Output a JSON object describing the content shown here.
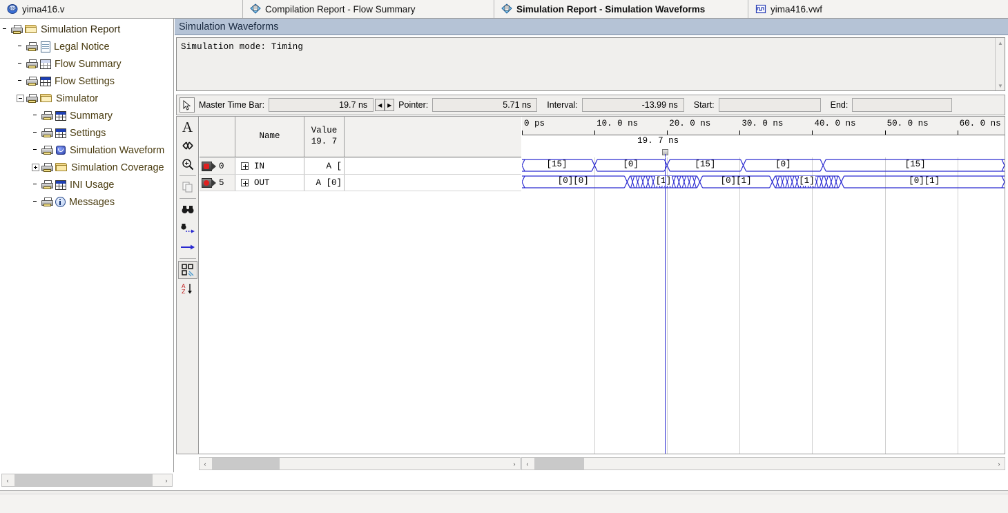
{
  "tabs": [
    {
      "label": "yima416.v",
      "icon": "verilog-file-icon",
      "active": false
    },
    {
      "label": "Compilation Report - Flow Summary",
      "icon": "report-icon",
      "active": false
    },
    {
      "label": "Simulation Report - Simulation Waveforms",
      "icon": "report-icon",
      "active": true
    },
    {
      "label": "yima416.vwf",
      "icon": "waveform-file-icon",
      "active": false
    }
  ],
  "tree": {
    "items": [
      {
        "label": "Simulation Report",
        "depth": 0,
        "icon": "folder-open-icon",
        "expander": "none"
      },
      {
        "label": "Legal Notice",
        "depth": 1,
        "icon": "document-icon",
        "expander": "none"
      },
      {
        "label": "Flow Summary",
        "depth": 1,
        "icon": "table-pale-icon",
        "expander": "none"
      },
      {
        "label": "Flow Settings",
        "depth": 1,
        "icon": "table-icon",
        "expander": "none"
      },
      {
        "label": "Simulator",
        "depth": 1,
        "icon": "folder-open-icon",
        "expander": "minus"
      },
      {
        "label": "Summary",
        "depth": 2,
        "icon": "table-icon",
        "expander": "none"
      },
      {
        "label": "Settings",
        "depth": 2,
        "icon": "table-icon",
        "expander": "none"
      },
      {
        "label": "Simulation Waveform",
        "depth": 2,
        "icon": "waveform-icon",
        "expander": "none"
      },
      {
        "label": "Simulation Coverage",
        "depth": 2,
        "icon": "folder-icon",
        "expander": "plus"
      },
      {
        "label": "INI Usage",
        "depth": 2,
        "icon": "table-icon",
        "expander": "none"
      },
      {
        "label": "Messages",
        "depth": 2,
        "icon": "info-icon",
        "expander": "none"
      }
    ]
  },
  "panel": {
    "title": "Simulation Waveforms",
    "mode_text": "Simulation mode: Timing"
  },
  "timebar": {
    "pointer_tool_icon": "arrow-cursor-icon",
    "master_time_bar_label": "Master Time Bar:",
    "master_time_bar_value": "19.7 ns",
    "pointer_label": "Pointer:",
    "pointer_value": "5.71 ns",
    "interval_label": "Interval:",
    "interval_value": "-13.99 ns",
    "start_label": "Start:",
    "start_value": "",
    "end_label": "End:",
    "end_value": ""
  },
  "wave_tools": [
    {
      "name": "select-arrow-tool",
      "glyph": "△"
    },
    {
      "name": "text-tool",
      "glyph": "A"
    },
    {
      "name": "waveform-editing-tool",
      "glyph": "⨉"
    },
    {
      "name": "zoom-tool",
      "glyph": "⊕"
    },
    {
      "name": "copy-tool",
      "glyph": "⧉"
    },
    {
      "name": "find-tool",
      "glyph": "☎"
    },
    {
      "name": "find-next-tool",
      "glyph": "➜"
    },
    {
      "name": "goto-tool",
      "glyph": "→"
    },
    {
      "name": "node-finder-tool",
      "glyph": "⌸"
    },
    {
      "name": "sort-az-tool",
      "glyph": "AZ↓"
    }
  ],
  "grid": {
    "headers": {
      "index": "",
      "name": "Name",
      "value_line1": "Value",
      "value_line2": "19. 7"
    },
    "rows": [
      {
        "index": "0",
        "pin": "input-pin-icon",
        "name": "IN",
        "value": "A [",
        "expander": "plus"
      },
      {
        "index": "5",
        "pin": "output-pin-icon",
        "name": "OUT",
        "value": "A [0]",
        "expander": "plus"
      }
    ]
  },
  "chart_data": {
    "type": "timing-waveform",
    "title": "Simulation Waveforms",
    "xlabel": "time",
    "x_unit": "ns",
    "xlim": [
      0,
      66.5
    ],
    "ticks": [
      {
        "value": 0,
        "label": "0 ps"
      },
      {
        "value": 10,
        "label": "10. 0 ns"
      },
      {
        "value": 20,
        "label": "20. 0 ns"
      },
      {
        "value": 30,
        "label": "30. 0 ns"
      },
      {
        "value": 40,
        "label": "40. 0 ns"
      },
      {
        "value": 50,
        "label": "50. 0 ns"
      },
      {
        "value": 60,
        "label": "60. 0 ns"
      }
    ],
    "cursor": {
      "name": "master-time-bar",
      "value": 19.7,
      "label": "19. 7 ns"
    },
    "series": [
      {
        "name": "IN",
        "type": "bus",
        "segments": [
          {
            "start": 0,
            "end": 10,
            "label": "[15]"
          },
          {
            "start": 10,
            "end": 20,
            "label": "[0]"
          },
          {
            "start": 20,
            "end": 30.5,
            "label": "[15]"
          },
          {
            "start": 30.5,
            "end": 41.5,
            "label": "[0]"
          },
          {
            "start": 41.5,
            "end": 66.5,
            "label": "[15]"
          }
        ]
      },
      {
        "name": "OUT",
        "type": "bus",
        "segments": [
          {
            "start": 0,
            "end": 14.5,
            "label": "[0][0]"
          },
          {
            "start": 14.5,
            "end": 24.5,
            "label": "[1]",
            "glitch": true
          },
          {
            "start": 24.5,
            "end": 34.5,
            "label": "[0][1]"
          },
          {
            "start": 34.5,
            "end": 44.0,
            "label": "[1]",
            "glitch": true
          },
          {
            "start": 44.0,
            "end": 66.5,
            "label": "[0][1]"
          }
        ]
      }
    ]
  },
  "scrollbars": {
    "tree_hscroll": {
      "left_arrow": "‹",
      "right_arrow": "›"
    },
    "grid_hscroll": {
      "left_arrow": "‹",
      "right_arrow": "›"
    },
    "wave_hscroll": {
      "left_arrow": "‹",
      "right_arrow": "›"
    },
    "mode_vscroll": {
      "up_arrow": "▲",
      "down_arrow": "▼"
    }
  },
  "colors": {
    "wave_stroke": "#2a2ad0",
    "panel_header": "#b5c3d6",
    "chrome": "#f0efed",
    "gridline": "#cfcfcf"
  }
}
